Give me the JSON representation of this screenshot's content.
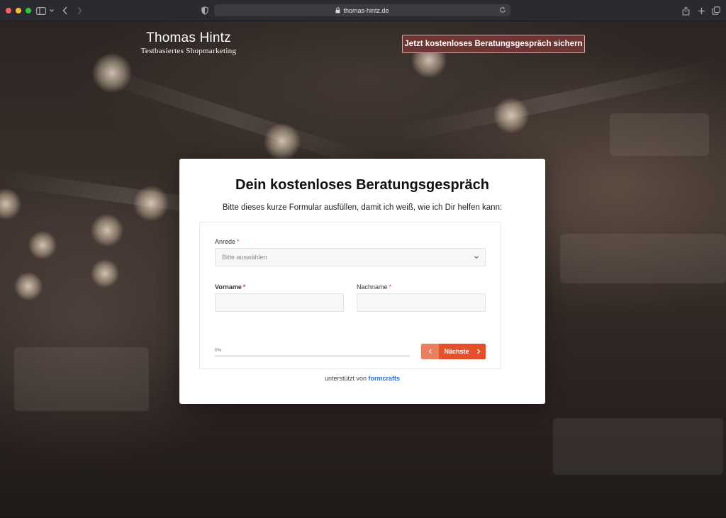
{
  "browser": {
    "url": "thomas-hintz.de",
    "icons": [
      "sidebar-icon",
      "chevron-down-icon",
      "back-icon",
      "forward-icon",
      "shield-icon",
      "lock-icon",
      "reload-icon",
      "share-icon",
      "plus-icon",
      "tabs-icon"
    ]
  },
  "header": {
    "brand_name": "Thomas Hintz",
    "brand_tagline": "Testbasiertes Shopmarketing",
    "cta_label": "Jetzt kostenloses Beratungsgespräch sichern"
  },
  "form": {
    "title": "Dein kostenloses Beratungsgespräch",
    "subtitle": "Bitte dieses kurze Formular ausfüllen, damit ich weiß, wie ich Dir helfen kann:",
    "required_marker": "*",
    "anrede": {
      "label": "Anrede",
      "placeholder": "Bitte auswählen"
    },
    "vorname": {
      "label": "Vorname",
      "value": ""
    },
    "nachname": {
      "label": "Nachname",
      "value": ""
    },
    "progress": {
      "label": "0%",
      "percent": 0
    },
    "next_label": "Nächste",
    "powered_by_prefix": "unterstützt von",
    "powered_by_brand": "formcrafts"
  },
  "colors": {
    "cta_bg": "#6e3535",
    "accent": "#e5502a",
    "link": "#2f6fd6"
  }
}
